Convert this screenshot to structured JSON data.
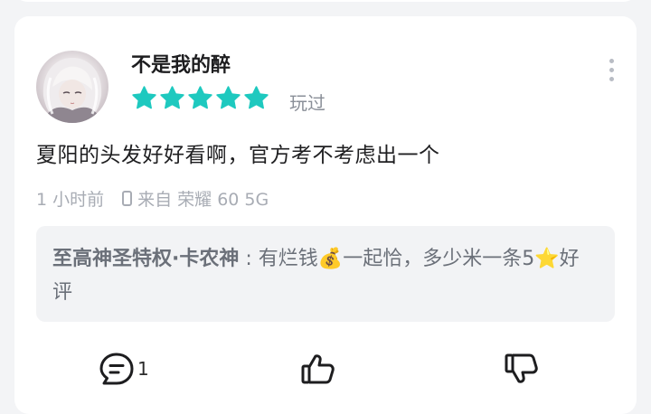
{
  "review": {
    "username": "不是我的醉",
    "rating": 5,
    "rating_max": 5,
    "played_label": "玩过",
    "content": "夏阳的头发好好看啊，官方考不考虑出一个",
    "time": "1 小时前",
    "device": "来自 荣耀 60 5G"
  },
  "reply": {
    "author": "至高神圣特权·卡农神",
    "separator": " : ",
    "text_part1": "有烂钱",
    "money_emoji": "💰",
    "text_part2": "一起恰，多少米一条5",
    "star_emoji": "⭐",
    "text_part3": "好评"
  },
  "actions": {
    "comment_count": "1"
  },
  "colors": {
    "star": "#1ec9bf",
    "card_bg": "#ffffff",
    "page_bg": "#f3f4f6",
    "reply_bg": "#f2f3f5"
  }
}
